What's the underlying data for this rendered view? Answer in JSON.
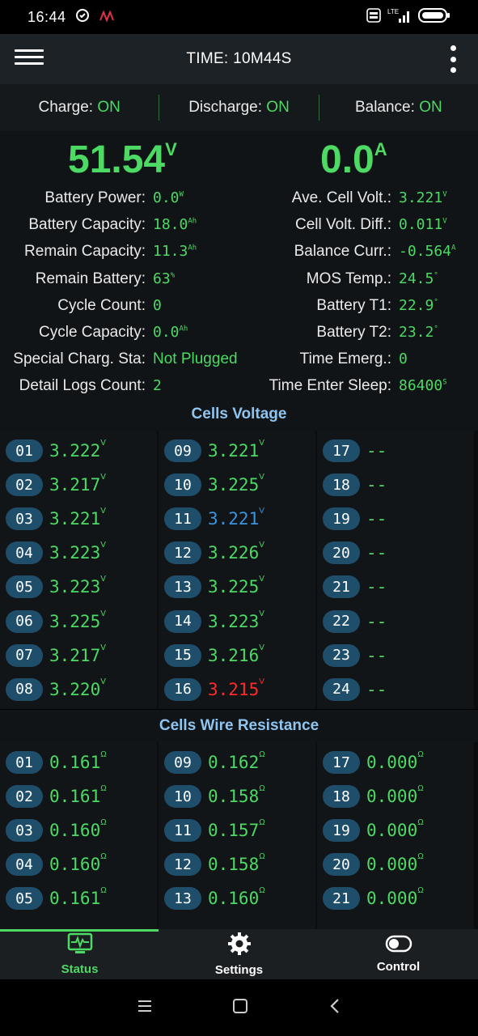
{
  "status_bar": {
    "time": "16:44",
    "network": "LTE"
  },
  "app_bar": {
    "title": "TIME: 10M44S"
  },
  "switches": [
    {
      "label": "Charge:",
      "value": "ON"
    },
    {
      "label": "Discharge:",
      "value": "ON"
    },
    {
      "label": "Balance:",
      "value": "ON"
    }
  ],
  "summary": {
    "voltage": "51.54",
    "voltage_unit": "V",
    "current": "0.0",
    "current_unit": "A"
  },
  "left_stats": [
    {
      "label": "Battery Power:",
      "value": "0.0",
      "unit": "W"
    },
    {
      "label": "Battery Capacity:",
      "value": "18.0",
      "unit": "Ah"
    },
    {
      "label": "Remain Capacity:",
      "value": "11.3",
      "unit": "Ah"
    },
    {
      "label": "Remain Battery:",
      "value": "63",
      "unit": "%"
    },
    {
      "label": "Cycle Count:",
      "value": "0",
      "unit": ""
    },
    {
      "label": "Cycle Capacity:",
      "value": "0.0",
      "unit": "Ah"
    },
    {
      "label": "Special Charg. Sta:",
      "value": "Not Plugged",
      "unit": ""
    },
    {
      "label": "Detail Logs Count:",
      "value": "2",
      "unit": ""
    }
  ],
  "right_stats": [
    {
      "label": "Ave. Cell Volt.:",
      "value": "3.221",
      "unit": "V"
    },
    {
      "label": "Cell Volt. Diff.:",
      "value": "0.011",
      "unit": "V"
    },
    {
      "label": "Balance Curr.:",
      "value": "-0.564",
      "unit": "A"
    },
    {
      "label": "MOS Temp.:",
      "value": "24.5",
      "unit": "°"
    },
    {
      "label": "Battery T1:",
      "value": "22.9",
      "unit": "°"
    },
    {
      "label": "Battery T2:",
      "value": "23.2",
      "unit": "°"
    },
    {
      "label": "Time Emerg.:",
      "value": "0",
      "unit": ""
    },
    {
      "label": "Time Enter Sleep:",
      "value": "86400",
      "unit": "S"
    }
  ],
  "cells_voltage": {
    "title": "Cells Voltage",
    "unit": "V",
    "cells": [
      {
        "id": "01",
        "value": "3.222",
        "state": "normal"
      },
      {
        "id": "02",
        "value": "3.217",
        "state": "normal"
      },
      {
        "id": "03",
        "value": "3.221",
        "state": "normal"
      },
      {
        "id": "04",
        "value": "3.223",
        "state": "normal"
      },
      {
        "id": "05",
        "value": "3.223",
        "state": "normal"
      },
      {
        "id": "06",
        "value": "3.225",
        "state": "normal"
      },
      {
        "id": "07",
        "value": "3.217",
        "state": "normal"
      },
      {
        "id": "08",
        "value": "3.220",
        "state": "normal"
      },
      {
        "id": "09",
        "value": "3.221",
        "state": "normal"
      },
      {
        "id": "10",
        "value": "3.225",
        "state": "normal"
      },
      {
        "id": "11",
        "value": "3.221",
        "state": "max"
      },
      {
        "id": "12",
        "value": "3.226",
        "state": "normal"
      },
      {
        "id": "13",
        "value": "3.225",
        "state": "normal"
      },
      {
        "id": "14",
        "value": "3.223",
        "state": "normal"
      },
      {
        "id": "15",
        "value": "3.216",
        "state": "normal"
      },
      {
        "id": "16",
        "value": "3.215",
        "state": "min"
      },
      {
        "id": "17",
        "value": "--",
        "state": "empty"
      },
      {
        "id": "18",
        "value": "--",
        "state": "empty"
      },
      {
        "id": "19",
        "value": "--",
        "state": "empty"
      },
      {
        "id": "20",
        "value": "--",
        "state": "empty"
      },
      {
        "id": "21",
        "value": "--",
        "state": "empty"
      },
      {
        "id": "22",
        "value": "--",
        "state": "empty"
      },
      {
        "id": "23",
        "value": "--",
        "state": "empty"
      },
      {
        "id": "24",
        "value": "--",
        "state": "empty"
      }
    ]
  },
  "cells_resistance": {
    "title": "Cells Wire Resistance",
    "unit": "Ω",
    "cells": [
      {
        "id": "01",
        "value": "0.161"
      },
      {
        "id": "02",
        "value": "0.161"
      },
      {
        "id": "03",
        "value": "0.160"
      },
      {
        "id": "04",
        "value": "0.160"
      },
      {
        "id": "05",
        "value": "0.161"
      },
      {
        "id": "09",
        "value": "0.162"
      },
      {
        "id": "10",
        "value": "0.158"
      },
      {
        "id": "11",
        "value": "0.157"
      },
      {
        "id": "12",
        "value": "0.158"
      },
      {
        "id": "13",
        "value": "0.160"
      },
      {
        "id": "17",
        "value": "0.000"
      },
      {
        "id": "18",
        "value": "0.000"
      },
      {
        "id": "19",
        "value": "0.000"
      },
      {
        "id": "20",
        "value": "0.000"
      },
      {
        "id": "21",
        "value": "0.000"
      }
    ]
  },
  "tabs": [
    {
      "label": "Status",
      "icon": "monitor-icon",
      "active": true
    },
    {
      "label": "Settings",
      "icon": "gear-icon",
      "active": false
    },
    {
      "label": "Control",
      "icon": "toggle-icon",
      "active": false
    }
  ],
  "colors": {
    "accent": "#4cd964",
    "max": "#3a95e0",
    "min": "#ff2a2a",
    "section_title": "#8ec5f0"
  }
}
